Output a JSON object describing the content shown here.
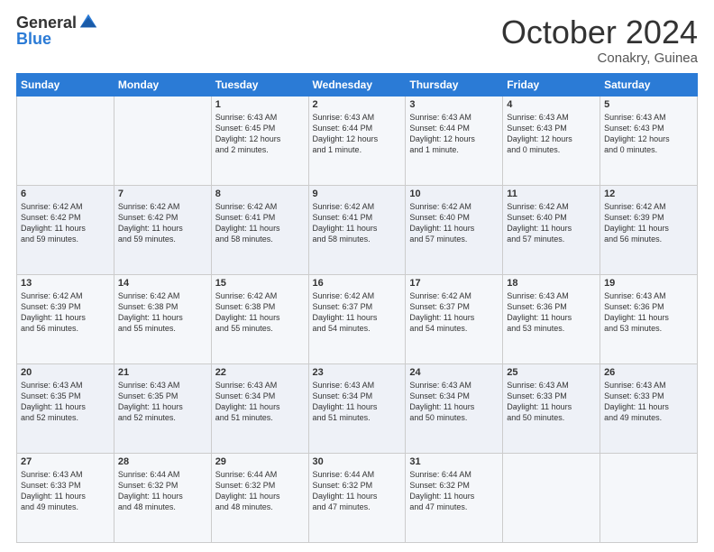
{
  "header": {
    "logo_general": "General",
    "logo_blue": "Blue",
    "month_title": "October 2024",
    "location": "Conakry, Guinea"
  },
  "weekdays": [
    "Sunday",
    "Monday",
    "Tuesday",
    "Wednesday",
    "Thursday",
    "Friday",
    "Saturday"
  ],
  "weeks": [
    [
      {
        "day": "",
        "info": ""
      },
      {
        "day": "",
        "info": ""
      },
      {
        "day": "1",
        "info": "Sunrise: 6:43 AM\nSunset: 6:45 PM\nDaylight: 12 hours\nand 2 minutes."
      },
      {
        "day": "2",
        "info": "Sunrise: 6:43 AM\nSunset: 6:44 PM\nDaylight: 12 hours\nand 1 minute."
      },
      {
        "day": "3",
        "info": "Sunrise: 6:43 AM\nSunset: 6:44 PM\nDaylight: 12 hours\nand 1 minute."
      },
      {
        "day": "4",
        "info": "Sunrise: 6:43 AM\nSunset: 6:43 PM\nDaylight: 12 hours\nand 0 minutes."
      },
      {
        "day": "5",
        "info": "Sunrise: 6:43 AM\nSunset: 6:43 PM\nDaylight: 12 hours\nand 0 minutes."
      }
    ],
    [
      {
        "day": "6",
        "info": "Sunrise: 6:42 AM\nSunset: 6:42 PM\nDaylight: 11 hours\nand 59 minutes."
      },
      {
        "day": "7",
        "info": "Sunrise: 6:42 AM\nSunset: 6:42 PM\nDaylight: 11 hours\nand 59 minutes."
      },
      {
        "day": "8",
        "info": "Sunrise: 6:42 AM\nSunset: 6:41 PM\nDaylight: 11 hours\nand 58 minutes."
      },
      {
        "day": "9",
        "info": "Sunrise: 6:42 AM\nSunset: 6:41 PM\nDaylight: 11 hours\nand 58 minutes."
      },
      {
        "day": "10",
        "info": "Sunrise: 6:42 AM\nSunset: 6:40 PM\nDaylight: 11 hours\nand 57 minutes."
      },
      {
        "day": "11",
        "info": "Sunrise: 6:42 AM\nSunset: 6:40 PM\nDaylight: 11 hours\nand 57 minutes."
      },
      {
        "day": "12",
        "info": "Sunrise: 6:42 AM\nSunset: 6:39 PM\nDaylight: 11 hours\nand 56 minutes."
      }
    ],
    [
      {
        "day": "13",
        "info": "Sunrise: 6:42 AM\nSunset: 6:39 PM\nDaylight: 11 hours\nand 56 minutes."
      },
      {
        "day": "14",
        "info": "Sunrise: 6:42 AM\nSunset: 6:38 PM\nDaylight: 11 hours\nand 55 minutes."
      },
      {
        "day": "15",
        "info": "Sunrise: 6:42 AM\nSunset: 6:38 PM\nDaylight: 11 hours\nand 55 minutes."
      },
      {
        "day": "16",
        "info": "Sunrise: 6:42 AM\nSunset: 6:37 PM\nDaylight: 11 hours\nand 54 minutes."
      },
      {
        "day": "17",
        "info": "Sunrise: 6:42 AM\nSunset: 6:37 PM\nDaylight: 11 hours\nand 54 minutes."
      },
      {
        "day": "18",
        "info": "Sunrise: 6:43 AM\nSunset: 6:36 PM\nDaylight: 11 hours\nand 53 minutes."
      },
      {
        "day": "19",
        "info": "Sunrise: 6:43 AM\nSunset: 6:36 PM\nDaylight: 11 hours\nand 53 minutes."
      }
    ],
    [
      {
        "day": "20",
        "info": "Sunrise: 6:43 AM\nSunset: 6:35 PM\nDaylight: 11 hours\nand 52 minutes."
      },
      {
        "day": "21",
        "info": "Sunrise: 6:43 AM\nSunset: 6:35 PM\nDaylight: 11 hours\nand 52 minutes."
      },
      {
        "day": "22",
        "info": "Sunrise: 6:43 AM\nSunset: 6:34 PM\nDaylight: 11 hours\nand 51 minutes."
      },
      {
        "day": "23",
        "info": "Sunrise: 6:43 AM\nSunset: 6:34 PM\nDaylight: 11 hours\nand 51 minutes."
      },
      {
        "day": "24",
        "info": "Sunrise: 6:43 AM\nSunset: 6:34 PM\nDaylight: 11 hours\nand 50 minutes."
      },
      {
        "day": "25",
        "info": "Sunrise: 6:43 AM\nSunset: 6:33 PM\nDaylight: 11 hours\nand 50 minutes."
      },
      {
        "day": "26",
        "info": "Sunrise: 6:43 AM\nSunset: 6:33 PM\nDaylight: 11 hours\nand 49 minutes."
      }
    ],
    [
      {
        "day": "27",
        "info": "Sunrise: 6:43 AM\nSunset: 6:33 PM\nDaylight: 11 hours\nand 49 minutes."
      },
      {
        "day": "28",
        "info": "Sunrise: 6:44 AM\nSunset: 6:32 PM\nDaylight: 11 hours\nand 48 minutes."
      },
      {
        "day": "29",
        "info": "Sunrise: 6:44 AM\nSunset: 6:32 PM\nDaylight: 11 hours\nand 48 minutes."
      },
      {
        "day": "30",
        "info": "Sunrise: 6:44 AM\nSunset: 6:32 PM\nDaylight: 11 hours\nand 47 minutes."
      },
      {
        "day": "31",
        "info": "Sunrise: 6:44 AM\nSunset: 6:32 PM\nDaylight: 11 hours\nand 47 minutes."
      },
      {
        "day": "",
        "info": ""
      },
      {
        "day": "",
        "info": ""
      }
    ]
  ]
}
